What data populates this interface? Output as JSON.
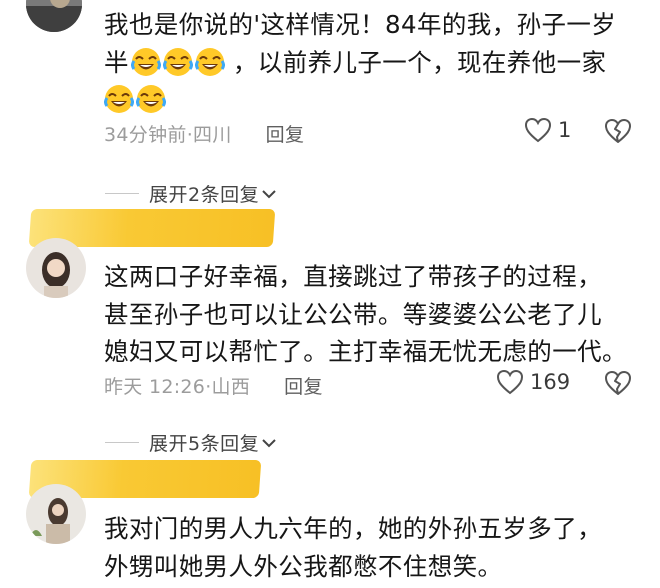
{
  "comments": [
    {
      "lines": [
        "我也是你说的'这样情况！84年的我，孙子一岁",
        "半",
        "，以前养儿子一个，现在养他一家"
      ],
      "emoji": "grinning-tears-emoji",
      "time": "34分钟前",
      "sep": "·",
      "location": "四川",
      "reply_label": "回复",
      "likes": "1"
    },
    {
      "lines": [
        "这两口子好幸福，直接跳过了带孩子的过程，",
        "甚至孙子也可以让公公带。等婆婆公公老了儿",
        "媳妇又可以帮忙了。主打幸福无忧无虑的一代。"
      ],
      "time": "昨天 12:26",
      "sep": "·",
      "location": "山西",
      "reply_label": "回复",
      "likes": "169"
    },
    {
      "lines": [
        "我对门的男人九六年的，她的外孙五岁多了，",
        "外甥叫她男人外公我都憋不住想笑。"
      ]
    }
  ],
  "expand_replies": [
    {
      "label": "展开2条回复",
      "icon": "chevron-down-icon"
    },
    {
      "label": "展开5条回复",
      "icon": "chevron-down-icon"
    }
  ],
  "colors": {
    "name_highlight": "#f7c025",
    "meta_gray": "#9c9c9c"
  }
}
